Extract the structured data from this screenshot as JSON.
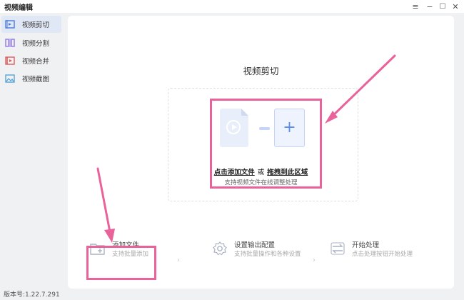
{
  "app_title": "视频编辑",
  "window_controls": {
    "menu": "≡",
    "minimize": "−",
    "maximize": "☐",
    "close": "✕"
  },
  "sidebar": {
    "items": [
      {
        "label": "视频剪切",
        "icon": "video-cut-icon",
        "active": true
      },
      {
        "label": "视频分割",
        "icon": "video-split-icon",
        "active": false
      },
      {
        "label": "视频合并",
        "icon": "video-merge-icon",
        "active": false
      },
      {
        "label": "视频截图",
        "icon": "video-screenshot-icon",
        "active": false
      }
    ]
  },
  "main": {
    "title": "视频剪切",
    "drop_zone": {
      "add_symbol": "+",
      "prompt_left": "点击添加文件",
      "prompt_sep": "或",
      "prompt_right": "拖拽到此区域",
      "hint": "支持视频文件在线调整处理"
    },
    "steps": [
      {
        "label": "添加文件",
        "sub": "支持批量添加",
        "icon": "add-folder-icon"
      },
      {
        "label": "设置输出配置",
        "sub": "支持批量操作和各种设置",
        "icon": "gear-icon"
      },
      {
        "label": "开始处理",
        "sub": "点击处理按钮开始处理",
        "icon": "process-icon"
      }
    ],
    "step_separator": "›"
  },
  "annotation_color": "#e9629a",
  "accent_color": "#5b8def",
  "version": "版本号:1.22.7.291"
}
